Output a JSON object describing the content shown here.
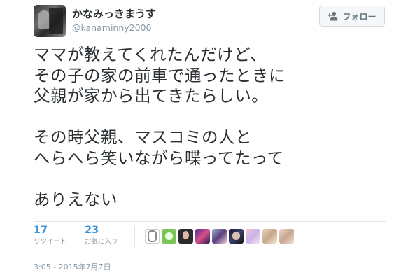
{
  "user": {
    "display_name": "かなみっきまうす",
    "screen_name": "@kanaminny2000"
  },
  "follow_button": {
    "label": "フォロー",
    "icon": "add-user-icon"
  },
  "tweet": {
    "lines": [
      "ママが教えてくれたんだけど、",
      "その子の家の前車で通ったときに",
      "父親が家から出てきたらしい。",
      "",
      "その時父親、マスコミの人と",
      "へらへら笑いながら喋ってたって",
      "",
      "ありえない"
    ]
  },
  "stats": {
    "retweets": {
      "count": "17",
      "label": "リツイート"
    },
    "favorites": {
      "count": "23",
      "label": "お気に入り"
    }
  },
  "likers": [
    "liker-avatar-1",
    "liker-avatar-2",
    "liker-avatar-3",
    "liker-avatar-4",
    "liker-avatar-5",
    "liker-avatar-6",
    "liker-avatar-7",
    "liker-avatar-8",
    "liker-avatar-9"
  ],
  "timestamp": "3:05 - 2015年7月7日",
  "colors": {
    "accent": "#3b94d9",
    "muted": "#8899a6",
    "text": "#292f33",
    "divider": "#e1e8ed"
  }
}
